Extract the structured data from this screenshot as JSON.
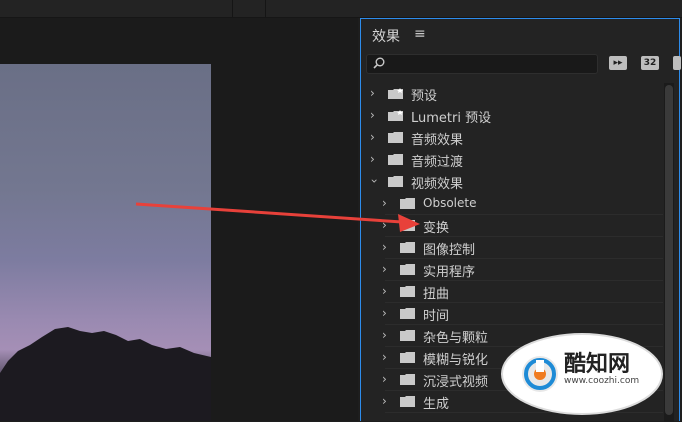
{
  "panel": {
    "title": "效果",
    "menu_icon": "hamburger-menu-icon",
    "search": {
      "placeholder": "",
      "icon": "search-icon"
    },
    "tools": [
      {
        "name": "accelerated-effects-icon",
        "glyph": ""
      },
      {
        "name": "32-bit-effects-icon",
        "glyph": "32"
      },
      {
        "name": "yuv-effects-icon",
        "glyph": ""
      }
    ]
  },
  "tree": [
    {
      "label": "预设",
      "expanded": false
    },
    {
      "label": "Lumetri 预设",
      "expanded": false
    },
    {
      "label": "音频效果",
      "expanded": false
    },
    {
      "label": "音频过渡",
      "expanded": false
    },
    {
      "label": "视频效果",
      "expanded": true
    },
    {
      "label": "Obsolete"
    },
    {
      "label": "变换"
    },
    {
      "label": "图像控制"
    },
    {
      "label": "实用程序"
    },
    {
      "label": "扭曲"
    },
    {
      "label": "时间"
    },
    {
      "label": "杂色与颗粒"
    },
    {
      "label": "模糊与锐化"
    },
    {
      "label": "沉浸式视频"
    },
    {
      "label": "生成"
    }
  ],
  "watermark": {
    "brand": "酷知网",
    "url": "www.coozhi.com"
  },
  "colors": {
    "accent": "#2d8ceb",
    "arrow": "#e8413a"
  }
}
